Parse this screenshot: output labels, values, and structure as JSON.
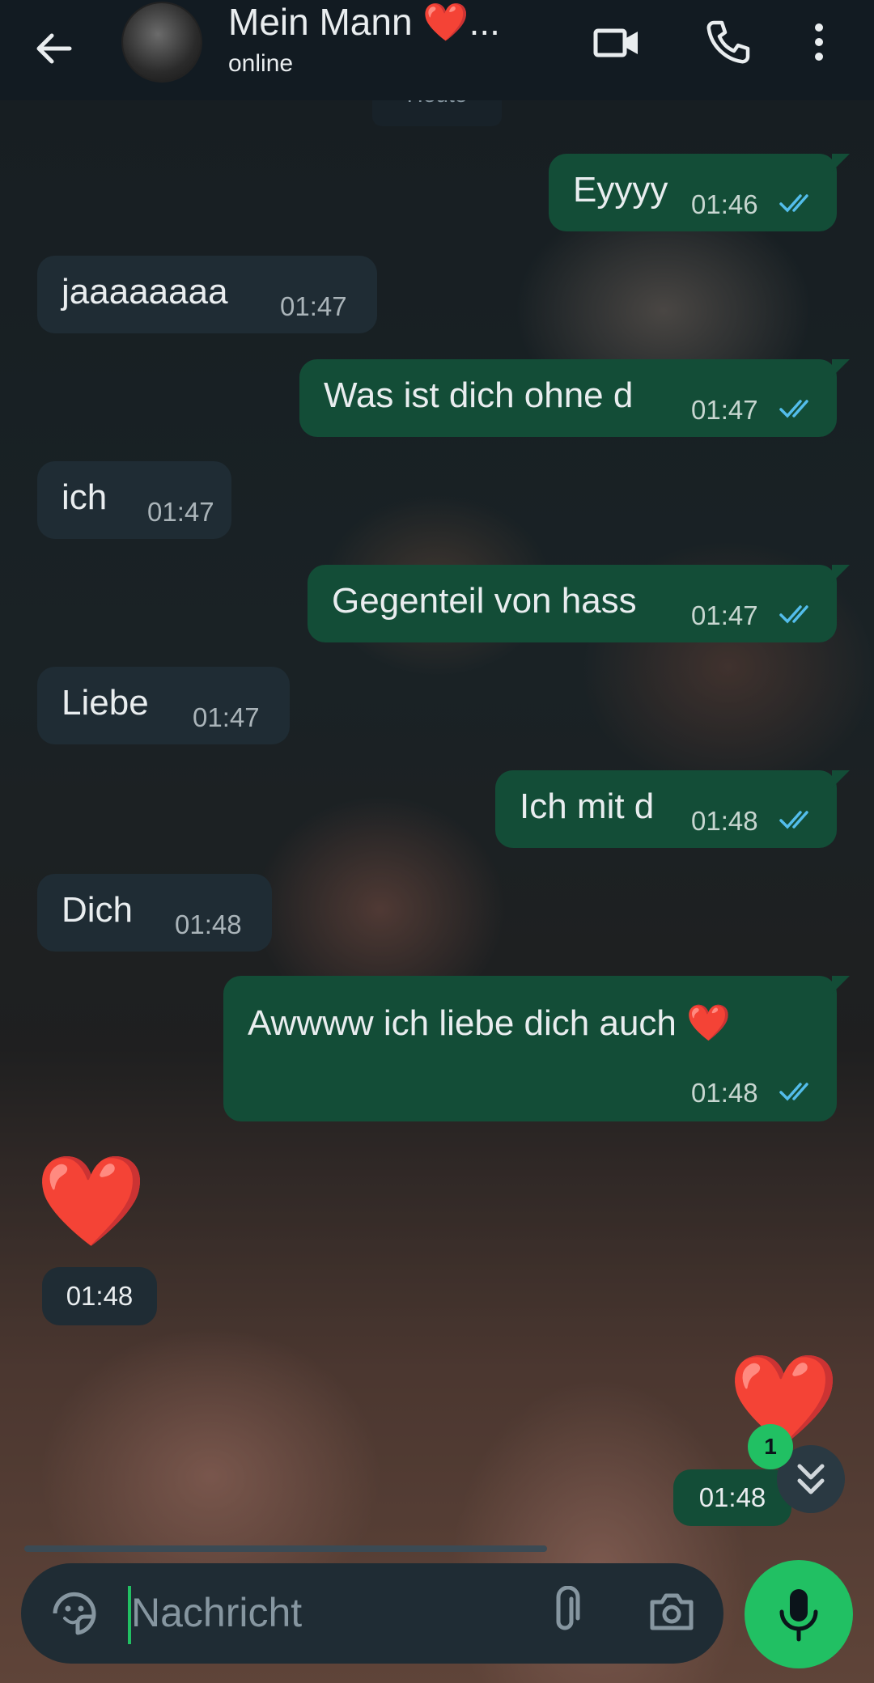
{
  "header": {
    "contact_name": "Mein Mann ❤️...",
    "status": "online"
  },
  "date_chip": "Heute",
  "messages": [
    {
      "dir": "out",
      "text": "Eyyyy",
      "time": "01:46"
    },
    {
      "dir": "in",
      "text": "jaaaaaaaa",
      "time": "01:47"
    },
    {
      "dir": "out",
      "text": "Was ist dich ohne d",
      "time": "01:47"
    },
    {
      "dir": "in",
      "text": "ich",
      "time": "01:47"
    },
    {
      "dir": "out",
      "text": "Gegenteil von hass",
      "time": "01:47"
    },
    {
      "dir": "in",
      "text": "Liebe",
      "time": "01:47"
    },
    {
      "dir": "out",
      "text": "Ich mit d",
      "time": "01:48"
    },
    {
      "dir": "in",
      "text": "Dich",
      "time": "01:48"
    },
    {
      "dir": "out",
      "text": "Awwww ich liebe dich auch ❤️",
      "time": "01:48"
    },
    {
      "dir": "in",
      "text": "❤️",
      "time": "01:48"
    },
    {
      "dir": "out",
      "text": "❤️",
      "time": "01:48"
    }
  ],
  "unread_badge": "1",
  "input": {
    "placeholder": "Nachricht"
  },
  "colors": {
    "outgoing_bubble": "#134d37",
    "incoming_bubble": "#1f2c34",
    "accent": "#21c063",
    "read_tick": "#53bdeb"
  },
  "icons": [
    "back-arrow-icon",
    "video-call-icon",
    "phone-icon",
    "more-vert-icon",
    "sticker-icon",
    "attach-icon",
    "camera-icon",
    "mic-icon",
    "double-chevron-down-icon"
  ]
}
